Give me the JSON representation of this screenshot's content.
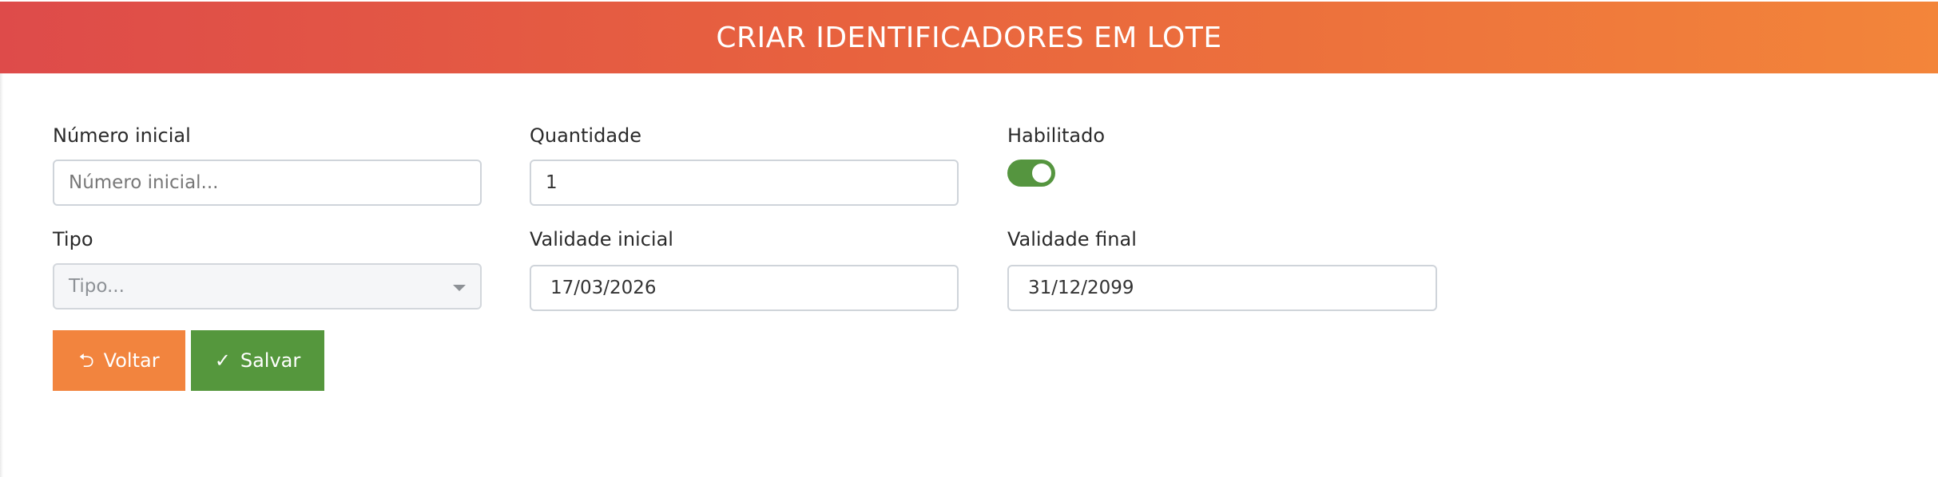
{
  "header": {
    "title": "CRIAR IDENTIFICADORES EM LOTE"
  },
  "form": {
    "numero_inicial": {
      "label": "Número inicial",
      "value": "",
      "placeholder": "Número inicial..."
    },
    "quantidade": {
      "label": "Quantidade",
      "value": "1"
    },
    "habilitado": {
      "label": "Habilitado",
      "on": true
    },
    "tipo": {
      "label": "Tipo",
      "placeholder": "Tipo..."
    },
    "validade_inicial": {
      "label": "Validade inicial",
      "value": "17/03/2026"
    },
    "validade_final": {
      "label": "Validade final",
      "value": "31/12/2099"
    }
  },
  "actions": {
    "back_label": "Voltar",
    "save_label": "Salvar",
    "back_icon": "return-arrow-icon",
    "save_icon": "check-icon"
  },
  "colors": {
    "header_start": "#de4b4a",
    "header_end": "#f3853a",
    "back_button": "#f2843e",
    "save_button": "#55973d",
    "toggle_on": "#55953f"
  }
}
